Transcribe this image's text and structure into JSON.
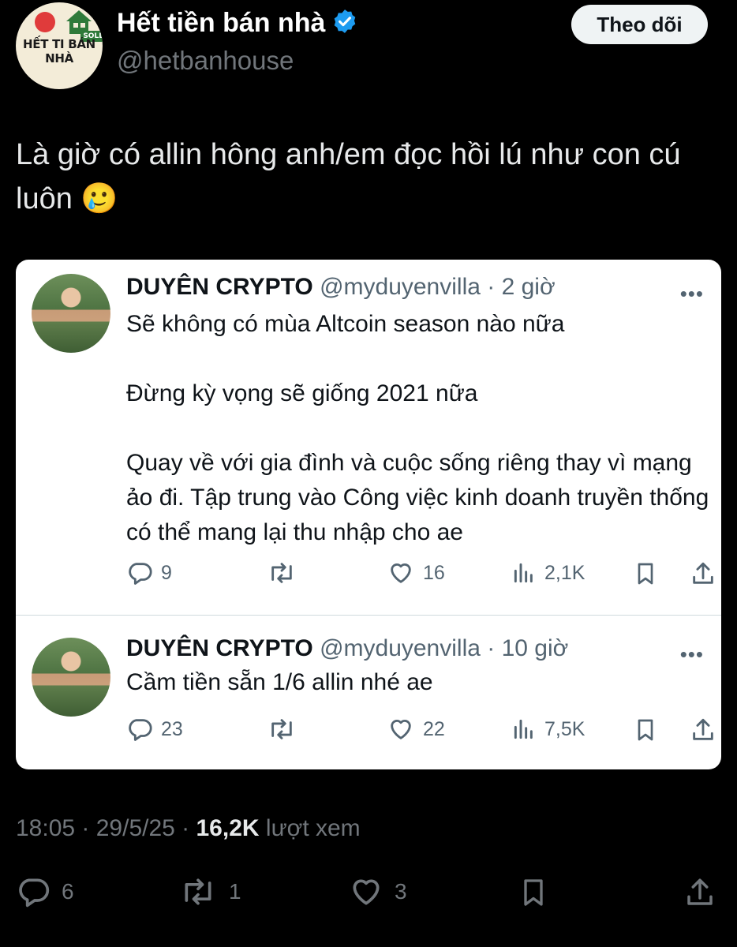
{
  "author": {
    "display_name": "Hết tiền bán nhà",
    "handle": "@hetbanhouse",
    "avatar_text": "HẾT TI BÁN NHÀ",
    "avatar_badge": "SOLD",
    "verified": true
  },
  "follow_label": "Theo dõi",
  "tweet": {
    "text": "Là giờ có allin hông anh/em đọc hồi lú như con cú luôn 🥲"
  },
  "quotes": [
    {
      "name": "DUYÊN CRYPTO",
      "meta": "@myduyenvilla · 2 giờ",
      "paragraphs": [
        "Sẽ không có mùa Altcoin season nào nữa",
        "Đừng kỳ vọng sẽ giống 2021 nữa",
        "Quay về với gia đình và cuộc sống riêng thay vì mạng ảo đi. Tập trung vào Công việc kinh doanh truyền thống có thể mang lại thu nhập cho ae"
      ],
      "replies": "9",
      "likes": "16",
      "views": "2,1K"
    },
    {
      "name": "DUYÊN CRYPTO",
      "meta": "@myduyenvilla · 10 giờ",
      "paragraphs": [
        "Cầm tiền sẵn 1/6 allin nhé ae"
      ],
      "replies": "23",
      "likes": "22",
      "views": "7,5K"
    }
  ],
  "timestamp": "18:05 · 29/5/25 · ",
  "views_count": "16,2K",
  "views_label": " lượt xem",
  "stats": {
    "replies": "6",
    "reposts": "1",
    "likes": "3"
  },
  "colors": {
    "background": "#000000",
    "card": "#ffffff",
    "verified": "#1d9bf0",
    "muted": "#71767b"
  }
}
